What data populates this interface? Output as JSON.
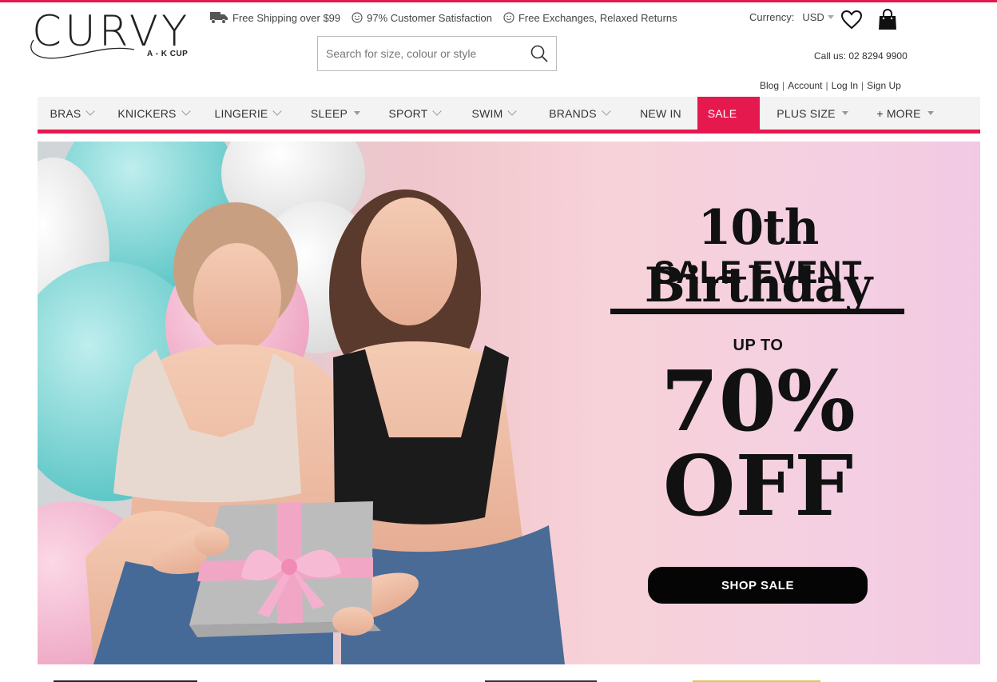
{
  "brand": {
    "name": "CURVY",
    "tagline": "A - K CUP"
  },
  "usps": [
    {
      "icon": "truck-icon",
      "label": "Free Shipping over $99"
    },
    {
      "icon": "smiley-icon",
      "label": "97% Customer Satisfaction"
    },
    {
      "icon": "smiley-icon",
      "label": "Free Exchanges, Relaxed Returns"
    }
  ],
  "currency": {
    "label": "Currency:",
    "value": "USD"
  },
  "search": {
    "placeholder": "Search for size, colour or style",
    "value": ""
  },
  "contact": {
    "call_us": "Call us: 02 8294 9900"
  },
  "account_links": [
    "Blog",
    "Account",
    "Log In",
    "Sign Up"
  ],
  "nav": [
    {
      "label": "BRAS",
      "indicator": "chevron"
    },
    {
      "label": "KNICKERS",
      "indicator": "chevron"
    },
    {
      "label": "LINGERIE",
      "indicator": "chevron"
    },
    {
      "label": "SLEEP",
      "indicator": "triangle"
    },
    {
      "label": "SPORT",
      "indicator": "chevron"
    },
    {
      "label": "SWIM",
      "indicator": "chevron"
    },
    {
      "label": "BRANDS",
      "indicator": "chevron"
    },
    {
      "label": "NEW IN",
      "indicator": "none"
    },
    {
      "label": "SALE",
      "indicator": "triangle",
      "active": true
    },
    {
      "label": "PLUS SIZE",
      "indicator": "triangle"
    },
    {
      "label": "+ MORE",
      "indicator": "triangle"
    }
  ],
  "hero": {
    "title": "10th Birthday",
    "subtitle": "SALE EVENT",
    "upto": "UP TO",
    "percent": "70%",
    "off": "OFF",
    "cta": "SHOP SALE"
  },
  "colors": {
    "accent": "#e6194f",
    "nav_bg": "#f3f3f3",
    "cta_bg": "#050505"
  }
}
